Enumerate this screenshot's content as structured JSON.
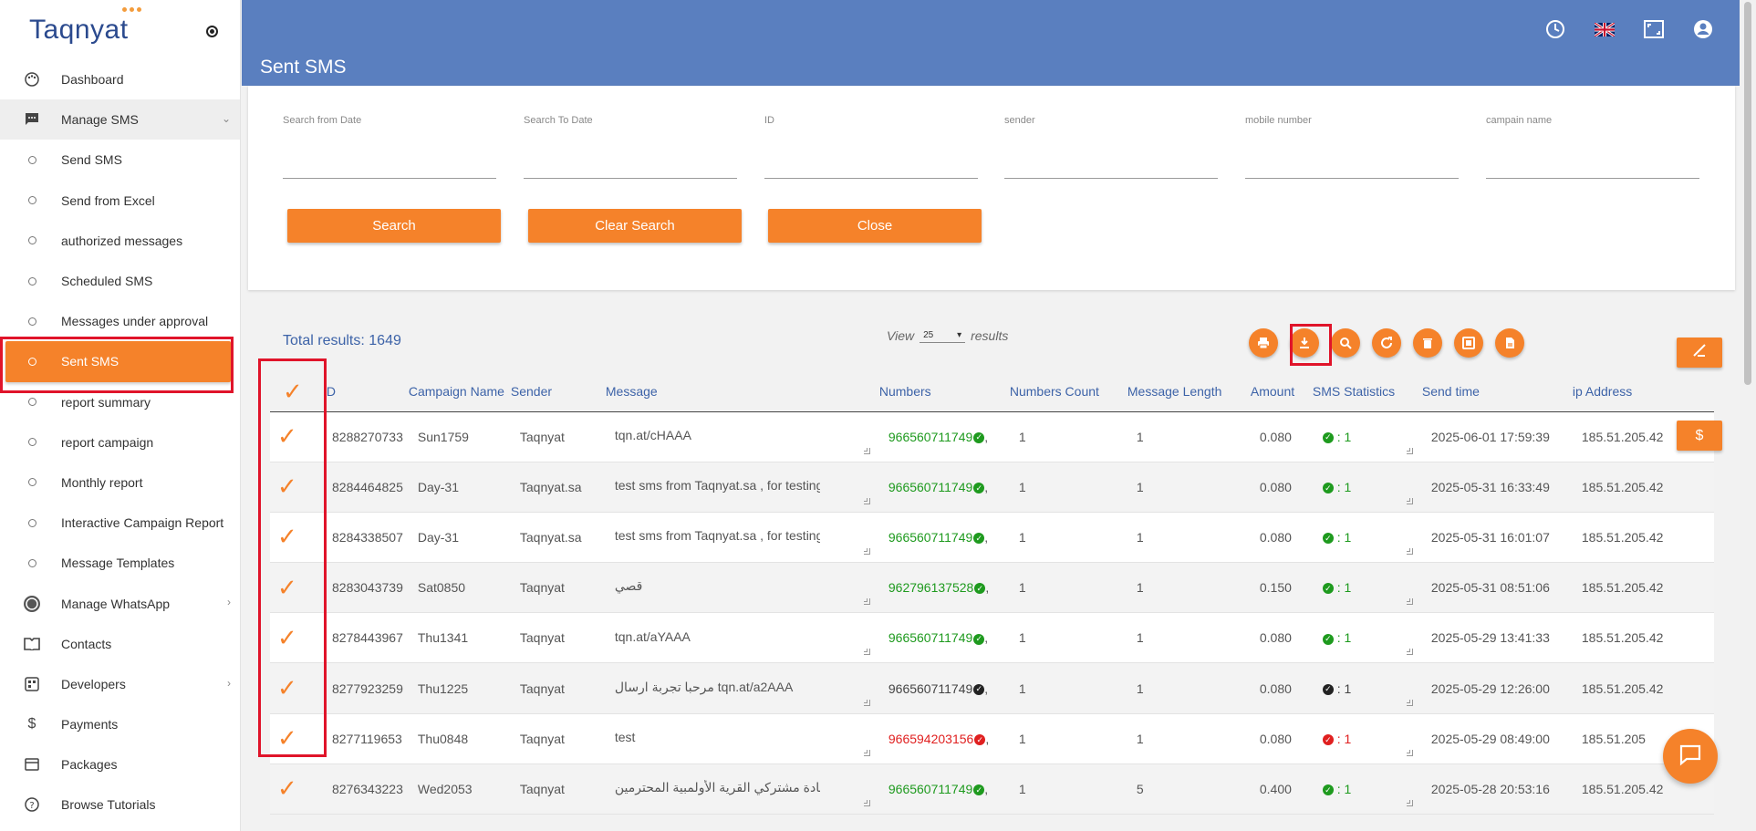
{
  "brand": {
    "logo_text": "Taqnyat",
    "accent": "#f5822a",
    "header_bg": "#5a7fbf"
  },
  "sidebar": {
    "items": [
      {
        "label": "Dashboard",
        "icon": "palette-icon"
      },
      {
        "label": "Manage SMS",
        "icon": "message-icon"
      },
      {
        "label": "Send SMS"
      },
      {
        "label": "Send from Excel"
      },
      {
        "label": "authorized messages"
      },
      {
        "label": "Scheduled SMS"
      },
      {
        "label": "Messages under approval"
      },
      {
        "label": "Sent SMS"
      },
      {
        "label": "report summary"
      },
      {
        "label": "report campaign"
      },
      {
        "label": "Monthly report"
      },
      {
        "label": "Interactive Campaign Report"
      },
      {
        "label": "Message Templates"
      },
      {
        "label": "Manage WhatsApp",
        "icon": "whatsapp-icon"
      },
      {
        "label": "Contacts",
        "icon": "book-icon"
      },
      {
        "label": "Developers",
        "icon": "code-icon"
      },
      {
        "label": "Payments",
        "icon": "dollar-icon"
      },
      {
        "label": "Packages",
        "icon": "package-icon"
      },
      {
        "label": "Browse Tutorials",
        "icon": "help-icon"
      }
    ]
  },
  "header": {
    "title": "Sent SMS",
    "icons": [
      "clock-icon",
      "uk-flag-icon",
      "fullscreen-icon",
      "account-icon"
    ]
  },
  "filters": {
    "fields": [
      "Search from Date",
      "Search To Date",
      "ID",
      "sender",
      "mobile number",
      "campain name"
    ],
    "buttons": {
      "search": "Search",
      "clear": "Clear Search",
      "close": "Close"
    }
  },
  "results": {
    "total_label": "Total results:",
    "total": "1649",
    "view_label": "View",
    "per_page": "25",
    "results_label": "results",
    "tools": [
      "print-icon",
      "download-icon",
      "search-icon",
      "refresh-icon",
      "delete-icon",
      "expand-icon",
      "file-icon"
    ]
  },
  "table": {
    "headers": [
      "ID",
      "Campaign Name",
      "Sender",
      "Message",
      "Numbers",
      "Numbers Count",
      "Message Length",
      "Amount",
      "SMS Statistics",
      "Send time",
      "ip Address"
    ],
    "rows": [
      {
        "id": "8288270733",
        "campaign": "Sun1759",
        "sender": "Taqnyat",
        "message": "tqn.at/cHAAA",
        "number": "966560711749",
        "status": "ok",
        "count": "1",
        "length": "1",
        "amount": "0.080",
        "stat": "1",
        "time": "2025-06-01 17:59:39",
        "ip": "185.51.205.42"
      },
      {
        "id": "8284464825",
        "campaign": "Day-31",
        "sender": "Taqnyat.sa",
        "message": "test sms from Taqnyat.sa , for testing",
        "number": "966560711749",
        "status": "ok",
        "count": "1",
        "length": "1",
        "amount": "0.080",
        "stat": "1",
        "time": "2025-05-31 16:33:49",
        "ip": "185.51.205.42"
      },
      {
        "id": "8284338507",
        "campaign": "Day-31",
        "sender": "Taqnyat.sa",
        "message": "test sms from Taqnyat.sa , for testing",
        "number": "966560711749",
        "status": "ok",
        "count": "1",
        "length": "1",
        "amount": "0.080",
        "stat": "1",
        "time": "2025-05-31 16:01:07",
        "ip": "185.51.205.42"
      },
      {
        "id": "8283043739",
        "campaign": "Sat0850",
        "sender": "Taqnyat",
        "message": "قصي",
        "number": "962796137528",
        "status": "ok",
        "count": "1",
        "length": "1",
        "amount": "0.150",
        "stat": "1",
        "time": "2025-05-31 08:51:06",
        "ip": "185.51.205.42"
      },
      {
        "id": "8278443967",
        "campaign": "Thu1341",
        "sender": "Taqnyat",
        "message": "tqn.at/aYAAA",
        "number": "966560711749",
        "status": "ok",
        "count": "1",
        "length": "1",
        "amount": "0.080",
        "stat": "1",
        "time": "2025-05-29 13:41:33",
        "ip": "185.51.205.42"
      },
      {
        "id": "8277923259",
        "campaign": "Thu1225",
        "sender": "Taqnyat",
        "message": "مرحبا تجربة ارسال tqn.at/a2AAA",
        "number": "966560711749",
        "status": "pending",
        "count": "1",
        "length": "1",
        "amount": "0.080",
        "stat": "1",
        "time": "2025-05-29 12:26:00",
        "ip": "185.51.205.42"
      },
      {
        "id": "8277119653",
        "campaign": "Thu0848",
        "sender": "Taqnyat",
        "message": "test",
        "number": "966594203156",
        "status": "fail",
        "count": "1",
        "length": "1",
        "amount": "0.080",
        "stat": "1",
        "time": "2025-05-29 08:49:00",
        "ip": "185.51.205"
      },
      {
        "id": "8276343223",
        "campaign": "Wed2053",
        "sender": "Taqnyat",
        "message": "سادة مشتركي القرية الأولمبية المحترمين",
        "number": "966560711749",
        "status": "ok",
        "count": "1",
        "length": "5",
        "amount": "0.400",
        "stat": "1",
        "time": "2025-05-28 20:53:16",
        "ip": "185.51.205.42"
      }
    ]
  },
  "side_tabs": [
    "send-icon",
    "$"
  ]
}
